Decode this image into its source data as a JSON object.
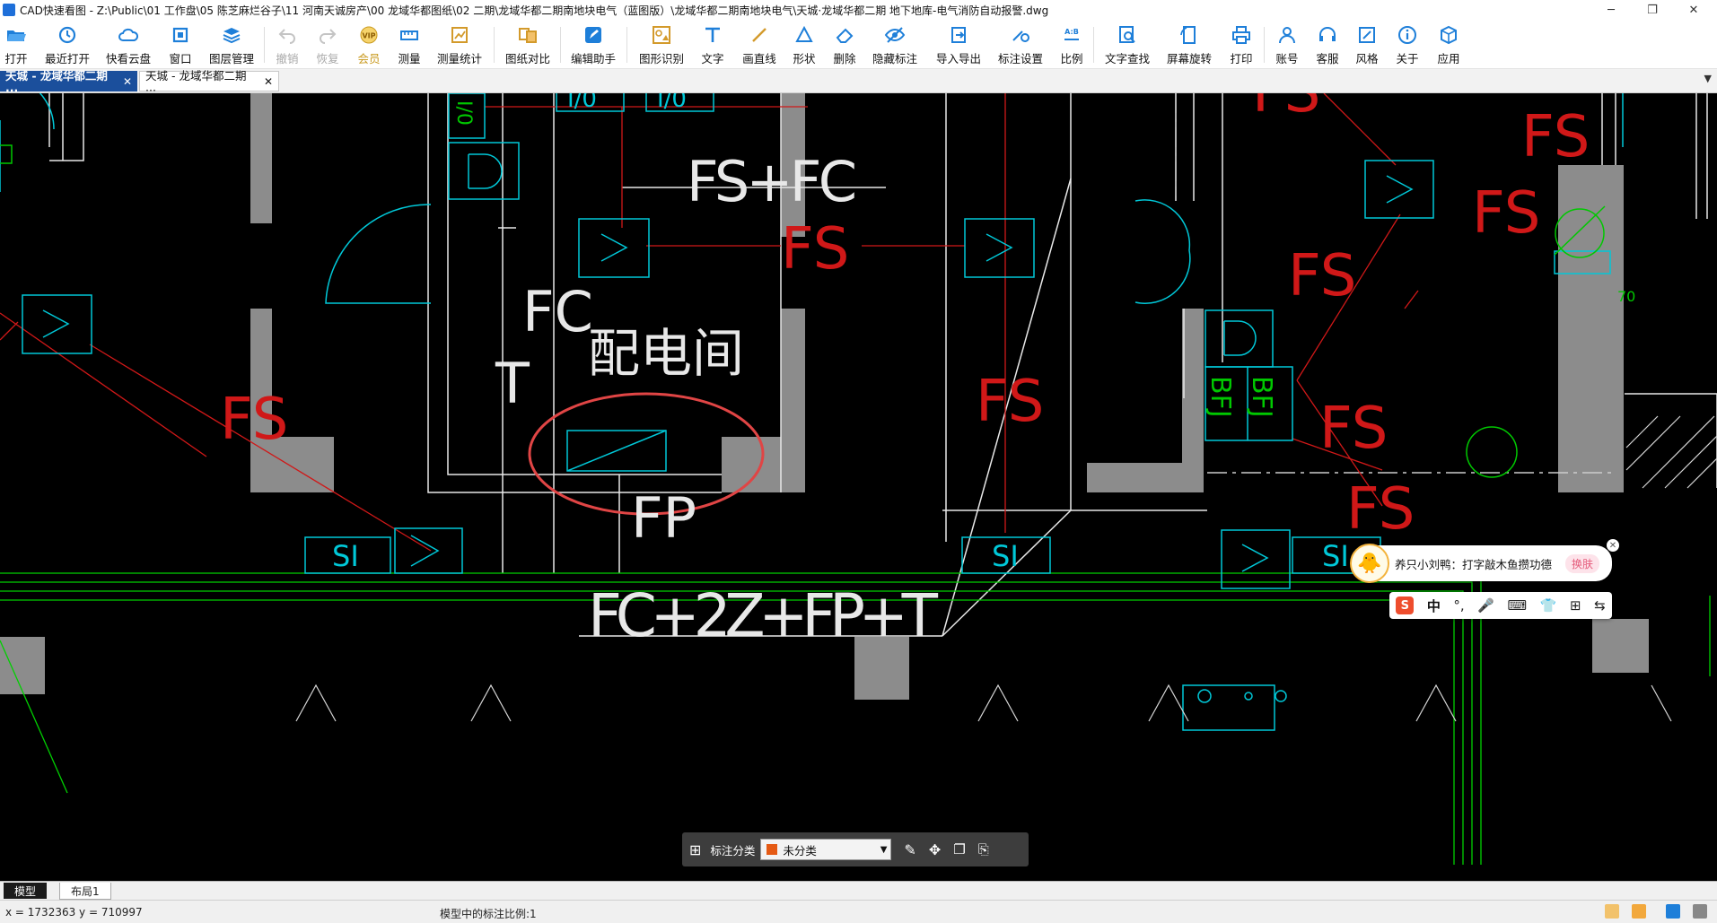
{
  "window": {
    "title": "CAD快速看图 - Z:\\Public\\01 工作盘\\05 陈芝麻烂谷子\\11 河南天诚房产\\00 龙域华都图纸\\02 二期\\龙域华都二期南地块电气（蓝图版）\\龙域华都二期南地块电气\\天城·龙域华都二期 地下地库-电气消防自动报警.dwg",
    "minimize": "─",
    "maximize": "❐",
    "close": "✕"
  },
  "toolbar": {
    "items": [
      {
        "label": "打开",
        "icon": "folder-open-icon",
        "enabled": true
      },
      {
        "label": "最近打开",
        "icon": "history-icon",
        "enabled": true
      },
      {
        "label": "快看云盘",
        "icon": "cloud-icon",
        "enabled": true
      },
      {
        "label": "窗口",
        "icon": "window-icon",
        "enabled": true
      },
      {
        "label": "图层管理",
        "icon": "layers-icon",
        "enabled": true
      },
      {
        "label": "撤销",
        "icon": "undo-icon",
        "enabled": false
      },
      {
        "label": "恢复",
        "icon": "redo-icon",
        "enabled": false
      },
      {
        "label": "会员",
        "icon": "vip-icon",
        "enabled": true
      },
      {
        "label": "测量",
        "icon": "ruler-icon",
        "enabled": true
      },
      {
        "label": "测量统计",
        "icon": "measure-stats-icon",
        "enabled": true
      },
      {
        "label": "图纸对比",
        "icon": "compare-icon",
        "enabled": true
      },
      {
        "label": "编辑助手",
        "icon": "edit-assistant-icon",
        "enabled": true
      },
      {
        "label": "图形识别",
        "icon": "shape-recognize-icon",
        "enabled": true
      },
      {
        "label": "文字",
        "icon": "text-icon",
        "enabled": true
      },
      {
        "label": "画直线",
        "icon": "line-icon",
        "enabled": true
      },
      {
        "label": "形状",
        "icon": "shape-icon",
        "enabled": true
      },
      {
        "label": "删除",
        "icon": "eraser-icon",
        "enabled": true
      },
      {
        "label": "隐藏标注",
        "icon": "eye-hide-icon",
        "enabled": true
      },
      {
        "label": "导入导出",
        "icon": "import-export-icon",
        "enabled": true
      },
      {
        "label": "标注设置",
        "icon": "annotation-settings-icon",
        "enabled": true
      },
      {
        "label": "比例",
        "icon": "scale-icon",
        "enabled": true
      },
      {
        "label": "文字查找",
        "icon": "text-search-icon",
        "enabled": true
      },
      {
        "label": "屏幕旋转",
        "icon": "rotate-screen-icon",
        "enabled": true
      },
      {
        "label": "打印",
        "icon": "printer-icon",
        "enabled": true
      },
      {
        "label": "账号",
        "icon": "user-icon",
        "enabled": true
      },
      {
        "label": "客服",
        "icon": "headset-icon",
        "enabled": true
      },
      {
        "label": "风格",
        "icon": "style-icon",
        "enabled": true
      },
      {
        "label": "关于",
        "icon": "info-icon",
        "enabled": true
      },
      {
        "label": "应用",
        "icon": "apps-cube-icon",
        "enabled": true
      }
    ]
  },
  "tabs": [
    {
      "label": "天城 - 龙域华都二期 ···",
      "close": "✕",
      "active": true
    },
    {
      "label": "天城 - 龙域华都二期 ···",
      "close": "✕",
      "active": false
    }
  ],
  "tab_overflow": "▼",
  "drawing": {
    "room_label": "配电间",
    "line_labels": {
      "fs_fc": "FS+FC",
      "fc": "FC",
      "t": "T",
      "fp": "FP",
      "main_bus": "FC+2Z+FP+T",
      "fs": "FS",
      "io": "I/0",
      "si": "SI",
      "bfj": "BFJ",
      "dim70": "70"
    },
    "colors": {
      "background": "#000000",
      "wiring_red": "#d01818",
      "device_cyan": "#00c8d8",
      "wall_gray": "#8c8c8c",
      "green": "#00d000",
      "highlight_circle": "#e04545"
    }
  },
  "annotation_bar": {
    "label": "标注分类",
    "selected": "未分类",
    "dropdown_arrow": "▼"
  },
  "layout_tabs": [
    {
      "label": "模型",
      "active": true
    },
    {
      "label": "布局1",
      "active": false
    }
  ],
  "status": {
    "coords": "x = 1732363  y = 710997",
    "scale_text": "模型中的标注比例:1"
  },
  "ime": {
    "tip_message": "养只小刘鸭：打字敲木鱼攒功德",
    "skin_button": "换肤",
    "close": "✕",
    "bar": {
      "logo": "S",
      "mode": "中",
      "punct": "°,",
      "voice": "🎤",
      "keyboard": "⌨",
      "shirt": "👕",
      "grid": "⊞",
      "extra": "⇆"
    }
  }
}
